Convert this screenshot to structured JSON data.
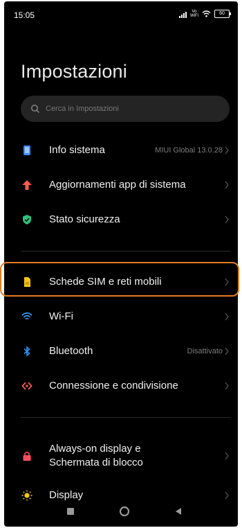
{
  "status": {
    "time": "15:05",
    "network": "Vo WiFi",
    "battery": "60"
  },
  "header": {
    "title": "Impostazioni"
  },
  "search": {
    "placeholder": "Cerca in Impostazioni"
  },
  "items": [
    {
      "label": "Info sistema",
      "value": "MIUI Global 13.0.28",
      "icon": "phone-info-icon",
      "color": "#3d8bff"
    },
    {
      "label": "Aggiornamenti app di sistema",
      "value": "",
      "icon": "arrow-up-icon",
      "color": "#ff5a4e"
    },
    {
      "label": "Stato sicurezza",
      "value": "",
      "icon": "shield-check-icon",
      "color": "#2ec27e"
    },
    {
      "label": "Schede SIM e reti mobili",
      "value": "",
      "icon": "sim-card-icon",
      "color": "#f5c518"
    },
    {
      "label": "Wi-Fi",
      "value": "",
      "icon": "wifi-icon",
      "color": "#2f9bff"
    },
    {
      "label": "Bluetooth",
      "value": "Disattivato",
      "icon": "bluetooth-icon",
      "color": "#2f9bff"
    },
    {
      "label": "Connessione e condivisione",
      "value": "",
      "icon": "share-connection-icon",
      "color": "#ff5a4e"
    },
    {
      "label": "Always-on display e\nSchermata di blocco",
      "value": "",
      "icon": "lock-icon",
      "color": "#ff4d5e"
    },
    {
      "label": "Display",
      "value": "",
      "icon": "sun-icon",
      "color": "#f5c518"
    }
  ],
  "highlight_color": "#e67e22"
}
